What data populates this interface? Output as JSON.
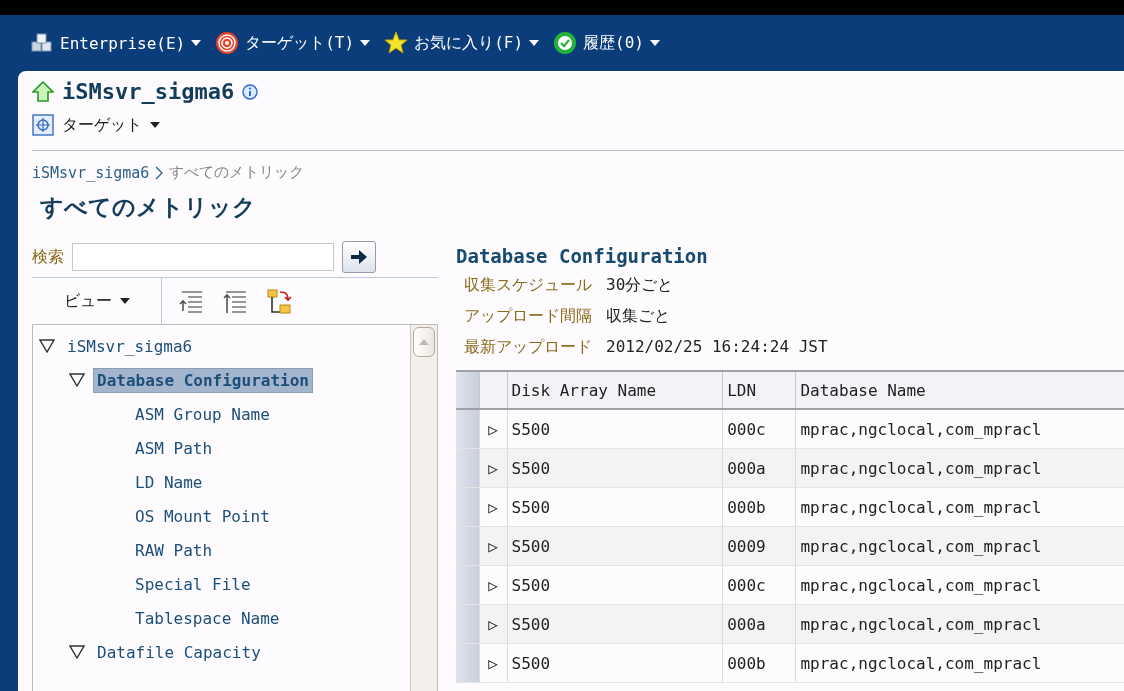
{
  "menu_bar": [
    {
      "label": "Enterprise(E)"
    },
    {
      "label": "ターゲット(T)"
    },
    {
      "label": "お気に入り(F)"
    },
    {
      "label": "履歴(0)"
    }
  ],
  "target": {
    "name": "iSMsvr_sigma6",
    "menu": "ターゲット"
  },
  "breadcrumb": {
    "items": [
      "iSMsvr_sigma6",
      "すべてのメトリック"
    ]
  },
  "page_title": "すべてのメトリック",
  "search": {
    "label": "検索"
  },
  "view_menu": "ビュー",
  "tree": [
    {
      "label": "iSMsvr_sigma6",
      "expanded": true,
      "selected": false,
      "children": [
        {
          "label": "Database Configuration",
          "expanded": true,
          "selected": true,
          "children": [
            {
              "label": "ASM Group Name",
              "selected": false
            },
            {
              "label": "ASM Path",
              "selected": false
            },
            {
              "label": "LD Name",
              "selected": false
            },
            {
              "label": "OS Mount Point",
              "selected": false
            },
            {
              "label": "RAW Path",
              "selected": false
            },
            {
              "label": "Special File",
              "selected": false
            },
            {
              "label": "Tablespace Name",
              "selected": false
            }
          ]
        },
        {
          "label": "Datafile Capacity",
          "expanded": true,
          "selected": false
        }
      ]
    }
  ],
  "detail": {
    "title": "Database Configuration",
    "properties": [
      {
        "label": "収集スケジュール",
        "value": "30分ごと"
      },
      {
        "label": "アップロード間隔",
        "value": "収集ごと"
      },
      {
        "label": "最新アップロード",
        "value": "2012/02/25 16:24:24 JST"
      }
    ],
    "table": {
      "columns": [
        "Disk Array Name",
        "LDN",
        "Database Name"
      ],
      "rows": [
        {
          "expander": "▷",
          "cells": [
            "S500",
            "000c",
            "mprac,ngclocal,com_mpracl"
          ]
        },
        {
          "expander": "▷",
          "cells": [
            "S500",
            "000a",
            "mprac,ngclocal,com_mpracl"
          ]
        },
        {
          "expander": "▷",
          "cells": [
            "S500",
            "000b",
            "mprac,ngclocal,com_mpracl"
          ]
        },
        {
          "expander": "▷",
          "cells": [
            "S500",
            "0009",
            "mprac,ngclocal,com_mpracl"
          ]
        },
        {
          "expander": "▷",
          "cells": [
            "S500",
            "000c",
            "mprac,ngclocal,com_mpracl"
          ]
        },
        {
          "expander": "▷",
          "cells": [
            "S500",
            "000a",
            "mprac,ngclocal,com_mpracl"
          ]
        },
        {
          "expander": "▷",
          "cells": [
            "S500",
            "000b",
            "mprac,ngclocal,com_mpracl"
          ]
        }
      ]
    }
  }
}
